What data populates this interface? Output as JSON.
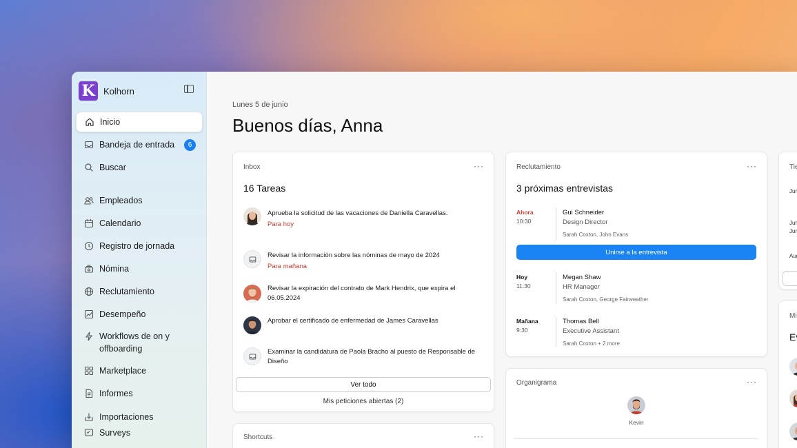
{
  "sidebar": {
    "brand": {
      "logo_letter": "K",
      "name": "Kolhorn"
    },
    "items": [
      {
        "label": "Inicio",
        "icon": "home-icon",
        "active": true
      },
      {
        "label": "Bandeja de entrada",
        "icon": "inbox-icon",
        "badge": "6"
      },
      {
        "label": "Buscar",
        "icon": "search-icon"
      },
      {
        "label": "Empleados",
        "icon": "people-icon"
      },
      {
        "label": "Calendario",
        "icon": "calendar-icon"
      },
      {
        "label": "Registro de jornada",
        "icon": "clock-icon"
      },
      {
        "label": "Nómina",
        "icon": "payroll-icon"
      },
      {
        "label": "Reclutamiento",
        "icon": "globe-icon"
      },
      {
        "label": "Desempeño",
        "icon": "chart-icon"
      },
      {
        "label": "Workflows de on y offboarding",
        "icon": "bolt-icon"
      },
      {
        "label": "Marketplace",
        "icon": "grid-icon"
      },
      {
        "label": "Informes",
        "icon": "document-icon"
      },
      {
        "label": "Importaciones",
        "icon": "import-icon"
      },
      {
        "label": "Surveys",
        "icon": "survey-icon"
      }
    ]
  },
  "header": {
    "date": "Lunes 5 de junio",
    "greeting": "Buenos días, Anna"
  },
  "inbox": {
    "label": "Inbox",
    "more": "···",
    "title": "16 Tareas",
    "tasks": [
      {
        "text": "Aprueba la solicitud de las vacaciones de Daniella Caravellas.",
        "due": "Para hoy",
        "kind": "avatar-woman"
      },
      {
        "text": "Revisar la información sobre las nóminas de mayo de 2024",
        "due": "Para mañana",
        "kind": "inbox"
      },
      {
        "text": "Revisar la expiración del contrato de Mark Hendrix, que expira el 06.05.2024",
        "due": "",
        "kind": "avatar-man-beard"
      },
      {
        "text": "Aprobar el certificado de enfermedad de James Caravellas",
        "due": "",
        "kind": "avatar-man-dark"
      },
      {
        "text": "Examinar la candidatura de Paola Bracho al puesto de Responsable de Diseño",
        "due": "",
        "kind": "inbox"
      }
    ],
    "view_all": "Ver todo",
    "open_requests": "Mis peticiones abiertas (2)"
  },
  "shortcuts": {
    "label": "Shortcuts",
    "more": "···"
  },
  "recruitment": {
    "label": "Reclutamiento",
    "more": "···",
    "title": "3 próximas entrevistas",
    "join_button": "Unirse a la entrevista",
    "interviews": [
      {
        "when": "Ahora",
        "time": "10:30",
        "name": "Gui Schneider",
        "role": "Design Director",
        "people": "Sarah Coxton, John Evans",
        "accent": "#d33b2f"
      },
      {
        "when": "Hoy",
        "time": "11:30",
        "name": "Megan Shaw",
        "role": "HR Manager",
        "people": "Sarah Coxton, George Fairweather",
        "accent": "#111111"
      },
      {
        "when": "Mañana",
        "time": "9:30",
        "name": "Thomas Bell",
        "role": "Executive Assistant",
        "people": "Sarah Coxton + 2 more",
        "accent": "#111111"
      }
    ]
  },
  "org": {
    "label": "Organigrama",
    "more": "···",
    "person": "Kevin"
  },
  "right_card": {
    "label": "Tie",
    "rows": [
      "Jun",
      "Jun",
      "Jun",
      "Aug"
    ]
  },
  "right_card2": {
    "label": "Mi",
    "title": "Ev"
  }
}
